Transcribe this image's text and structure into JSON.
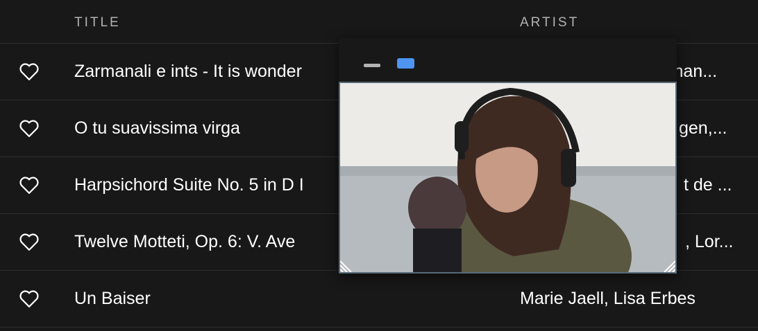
{
  "header": {
    "title_col": "TITLE",
    "artist_col": "ARTIST"
  },
  "tracks": [
    {
      "title": "Zarmanali e ints - It is wonder",
      "artist": "vhan..."
    },
    {
      "title": "O tu suavissima virga",
      "artist": "gen,..."
    },
    {
      "title": "Harpsichord Suite No. 5 in D I",
      "artist": "t de ..."
    },
    {
      "title": "Twelve Motteti, Op. 6: V. Ave",
      "artist": ", Lor..."
    },
    {
      "title": "Un Baiser",
      "artist": "Marie Jaell, Lisa Erbes"
    }
  ],
  "icons": {
    "heart": "heart-icon",
    "minimize": "minimize-icon",
    "camera": "camera-icon",
    "resize": "resize-handle-icon"
  },
  "colors": {
    "background": "#181818",
    "text": "#ffffff",
    "muted": "#b3b3b3",
    "accent": "#4e94f0",
    "video_border": "#596a78"
  }
}
